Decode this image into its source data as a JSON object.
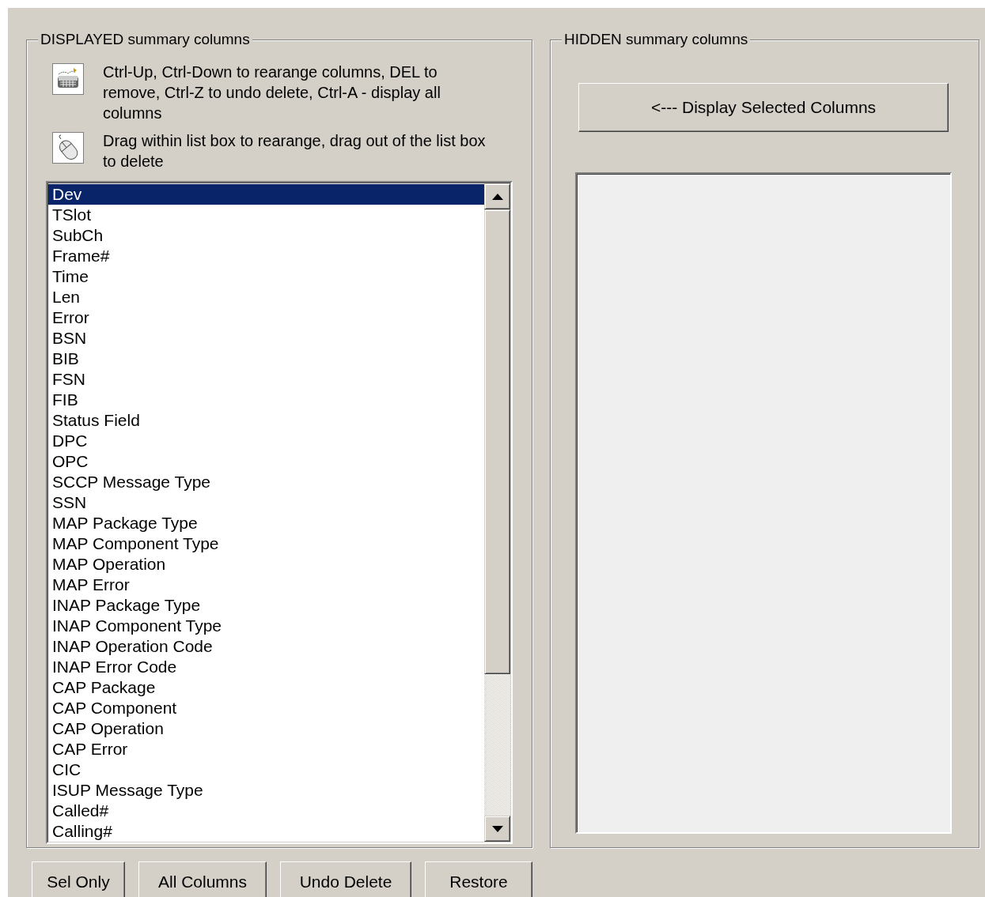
{
  "displayed": {
    "title": "DISPLAYED summary columns",
    "hints": [
      {
        "kind": "keyboard",
        "text": "Ctrl-Up, Ctrl-Down to rearange columns, DEL to remove, Ctrl-Z to undo delete, Ctrl-A - display all columns"
      },
      {
        "kind": "mouse",
        "text": "Drag within list box to rearange, drag out of the list box to delete"
      }
    ],
    "items": [
      {
        "label": "Dev",
        "selected": true
      },
      {
        "label": "TSlot",
        "selected": false
      },
      {
        "label": "SubCh",
        "selected": false
      },
      {
        "label": "Frame#",
        "selected": false
      },
      {
        "label": "Time",
        "selected": false
      },
      {
        "label": "Len",
        "selected": false
      },
      {
        "label": "Error",
        "selected": false
      },
      {
        "label": "BSN",
        "selected": false
      },
      {
        "label": "BIB",
        "selected": false
      },
      {
        "label": "FSN",
        "selected": false
      },
      {
        "label": "FIB",
        "selected": false
      },
      {
        "label": "Status Field",
        "selected": false
      },
      {
        "label": "DPC",
        "selected": false
      },
      {
        "label": "OPC",
        "selected": false
      },
      {
        "label": "SCCP Message Type",
        "selected": false
      },
      {
        "label": "SSN",
        "selected": false
      },
      {
        "label": "MAP Package Type",
        "selected": false
      },
      {
        "label": "MAP Component Type",
        "selected": false
      },
      {
        "label": "MAP Operation",
        "selected": false
      },
      {
        "label": "MAP Error",
        "selected": false
      },
      {
        "label": "INAP Package Type",
        "selected": false
      },
      {
        "label": "INAP Component Type",
        "selected": false
      },
      {
        "label": "INAP Operation Code",
        "selected": false
      },
      {
        "label": "INAP Error Code",
        "selected": false
      },
      {
        "label": "CAP Package",
        "selected": false
      },
      {
        "label": "CAP Component",
        "selected": false
      },
      {
        "label": "CAP Operation",
        "selected": false
      },
      {
        "label": "CAP Error",
        "selected": false
      },
      {
        "label": "CIC",
        "selected": false
      },
      {
        "label": "ISUP Message Type",
        "selected": false
      },
      {
        "label": "Called#",
        "selected": false
      },
      {
        "label": "Calling#",
        "selected": false
      }
    ]
  },
  "hidden": {
    "title": "HIDDEN summary columns",
    "button": "<--- Display Selected Columns"
  },
  "buttons": [
    "Sel Only",
    "All Columns",
    "Undo Delete",
    "Restore"
  ]
}
